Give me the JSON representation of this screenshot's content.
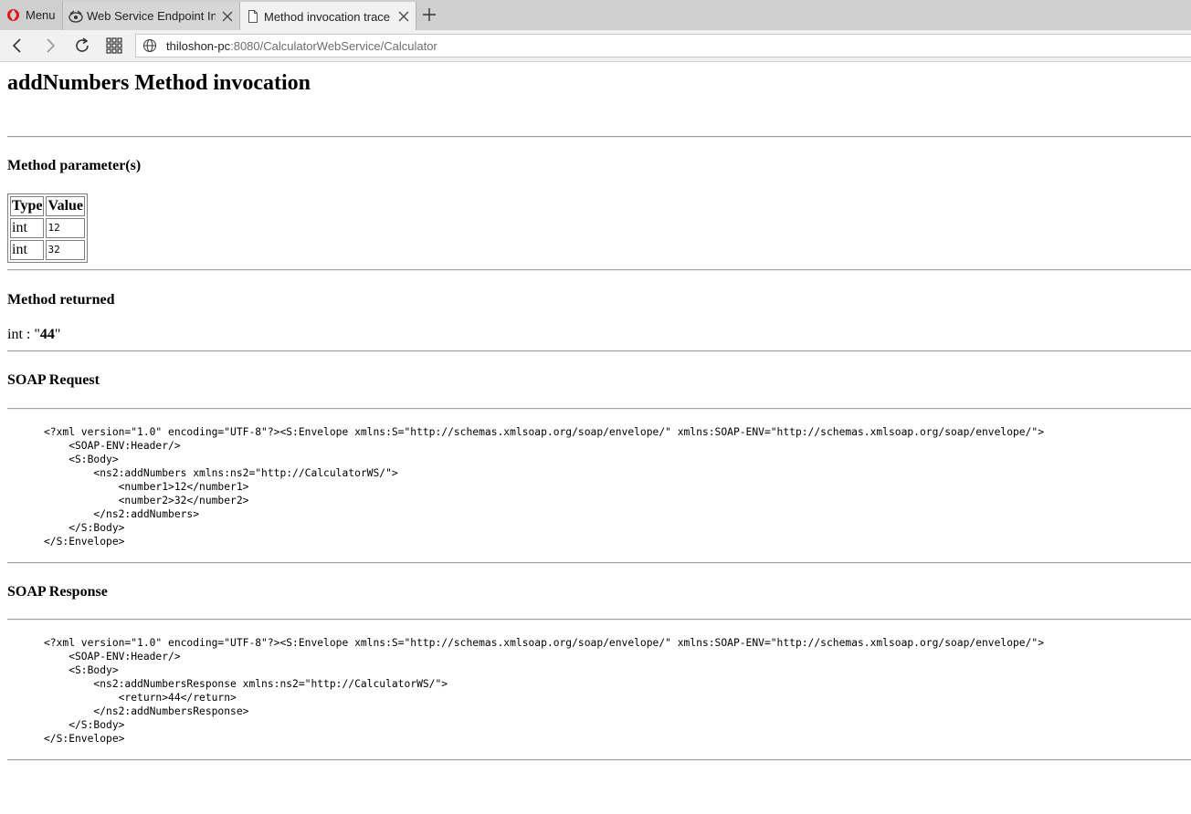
{
  "browser": {
    "menu_label": "Menu",
    "tabs": [
      {
        "title": "Web Service Endpoint Info",
        "active": false
      },
      {
        "title": "Method invocation trace",
        "active": true
      }
    ],
    "url_host": "thiloshon-pc",
    "url_rest": ":8080/CalculatorWebService/Calculator"
  },
  "page": {
    "title": "addNumbers Method invocation",
    "params_heading": "Method parameter(s)",
    "table": {
      "headers": [
        "Type",
        "Value"
      ],
      "rows": [
        {
          "type": "int",
          "value": "12"
        },
        {
          "type": "int",
          "value": "32"
        }
      ]
    },
    "returned_heading": "Method returned",
    "returned_type": "int : \"",
    "returned_value": "44",
    "returned_suffix": "\"",
    "request_heading": "SOAP Request",
    "request_xml": "<?xml version=\"1.0\" encoding=\"UTF-8\"?><S:Envelope xmlns:S=\"http://schemas.xmlsoap.org/soap/envelope/\" xmlns:SOAP-ENV=\"http://schemas.xmlsoap.org/soap/envelope/\">\n    <SOAP-ENV:Header/>\n    <S:Body>\n        <ns2:addNumbers xmlns:ns2=\"http://CalculatorWS/\">\n            <number1>12</number1>\n            <number2>32</number2>\n        </ns2:addNumbers>\n    </S:Body>\n</S:Envelope>",
    "response_heading": "SOAP Response",
    "response_xml": "<?xml version=\"1.0\" encoding=\"UTF-8\"?><S:Envelope xmlns:S=\"http://schemas.xmlsoap.org/soap/envelope/\" xmlns:SOAP-ENV=\"http://schemas.xmlsoap.org/soap/envelope/\">\n    <SOAP-ENV:Header/>\n    <S:Body>\n        <ns2:addNumbersResponse xmlns:ns2=\"http://CalculatorWS/\">\n            <return>44</return>\n        </ns2:addNumbersResponse>\n    </S:Body>\n</S:Envelope>"
  }
}
